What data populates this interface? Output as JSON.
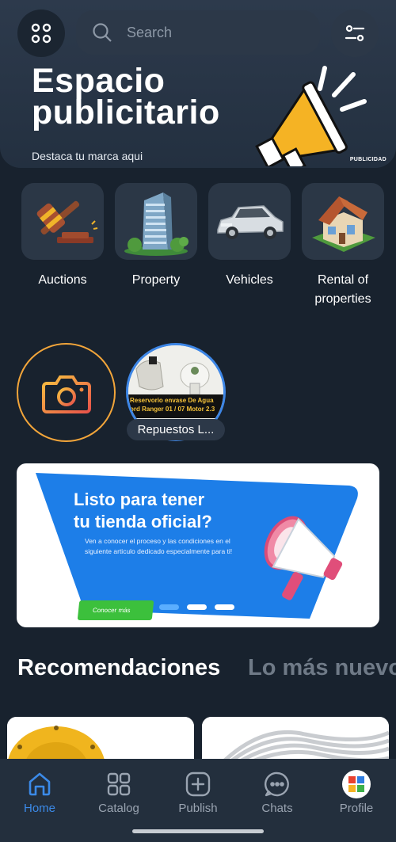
{
  "header": {
    "search_placeholder": "Search",
    "menu_icon": "grid-icon",
    "filter_icon": "filter-icon"
  },
  "banner": {
    "title_line1": "Espacio",
    "title_line2": "publicitario",
    "subtitle": "Destaca tu marca aqui",
    "tag": "PUBLICIDAD"
  },
  "categories": [
    {
      "label": "Auctions",
      "icon": "gavel-icon"
    },
    {
      "label": "Property",
      "icon": "building-icon"
    },
    {
      "label": "Vehicles",
      "icon": "car-icon"
    },
    {
      "label": "Rental of properties",
      "icon": "house-icon"
    }
  ],
  "stories": {
    "camera_icon": "camera-icon",
    "item_label": "Repuestos L...",
    "item_image_text_line1": "Reservorio envase De Agua",
    "item_image_text_line2": "ord Ranger 01 / 07 Motor 2.3"
  },
  "promo": {
    "title_line1": "Listo para tener",
    "title_line2": "tu tienda oficial?",
    "body": "Ven a conocer el proceso y las condiciones en el siguiente articulo dedicado especialmente para ti!",
    "button": "Conocer más",
    "slide_count": 3,
    "active_slide": 1
  },
  "sections": {
    "active": "Recomendaciones",
    "inactive": "Lo más nuevo"
  },
  "bottom_nav": [
    {
      "label": "Home",
      "icon": "home-icon",
      "active": true
    },
    {
      "label": "Catalog",
      "icon": "catalog-icon",
      "active": false
    },
    {
      "label": "Publish",
      "icon": "publish-icon",
      "active": false
    },
    {
      "label": "Chats",
      "icon": "chat-icon",
      "active": false
    },
    {
      "label": "Profile",
      "icon": "profile-avatar-icon",
      "active": false
    }
  ],
  "colors": {
    "background": "#18222e",
    "accent": "#3b8ae8",
    "camera_ring": "#f2a53a",
    "promo_blue": "#1d7ee8",
    "promo_button": "#3cc03c"
  }
}
